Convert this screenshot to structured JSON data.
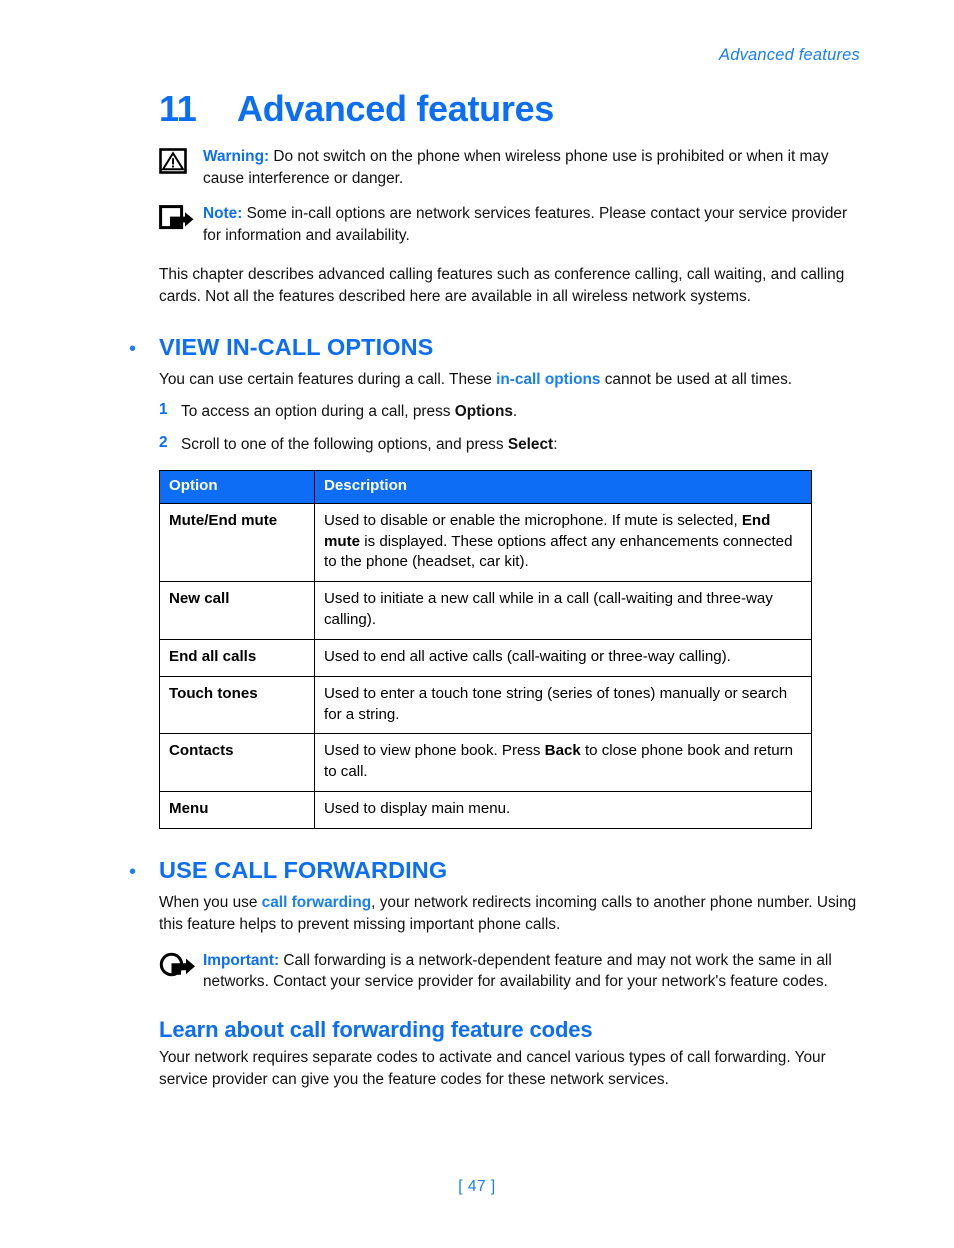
{
  "header": {
    "running_title": "Advanced features"
  },
  "chapter": {
    "number": "11",
    "title": "Advanced features"
  },
  "notices": [
    {
      "icon": "warning-triangle-icon",
      "label": "Warning:",
      "text": " Do not switch on the phone when wireless phone use is prohibited or when it may cause interference or danger."
    },
    {
      "icon": "note-arrow-icon",
      "label": "Note:",
      "text": " Some in-call options are network services features. Please contact your service provider for information and availability."
    }
  ],
  "intro_paragraph": "This chapter describes advanced calling features such as conference calling, call waiting, and calling cards. Not all the features described here are available in all wireless network systems.",
  "section_in_call": {
    "bullet": "•",
    "title": "VIEW IN-CALL OPTIONS",
    "intro_before": "You can use certain features during a call. These ",
    "intro_emphasis": "in-call options",
    "intro_after": " cannot be used at all times.",
    "steps": [
      {
        "num": "1",
        "before": "To access an option during a call, press ",
        "bold": "Options",
        "after": "."
      },
      {
        "num": "2",
        "before": "Scroll to one of the following options, and press ",
        "bold": "Select",
        "after": ":"
      }
    ],
    "table": {
      "columns": [
        "Option",
        "Description"
      ],
      "rows": [
        {
          "option": "Mute/End mute",
          "description_parts": [
            {
              "text": "Used to disable or enable the microphone. If mute is selected, ",
              "bold": false
            },
            {
              "text": "End mute",
              "bold": true
            },
            {
              "text": " is displayed. These options affect any enhancements connected to the phone (headset, car kit).",
              "bold": false
            }
          ]
        },
        {
          "option": "New call",
          "description_parts": [
            {
              "text": "Used to initiate a new call while in a call (call-waiting and three-way calling).",
              "bold": false
            }
          ]
        },
        {
          "option": "End all calls",
          "description_parts": [
            {
              "text": "Used to end all active calls (call-waiting or three-way calling).",
              "bold": false
            }
          ]
        },
        {
          "option": "Touch tones",
          "description_parts": [
            {
              "text": "Used to enter a touch tone string (series of tones) manually or search for a string.",
              "bold": false
            }
          ]
        },
        {
          "option": "Contacts",
          "description_parts": [
            {
              "text": "Used to view phone book. Press ",
              "bold": false
            },
            {
              "text": "Back",
              "bold": true
            },
            {
              "text": " to close phone book and return to call.",
              "bold": false
            }
          ]
        },
        {
          "option": "Menu",
          "description_parts": [
            {
              "text": "Used to display main menu.",
              "bold": false
            }
          ]
        }
      ]
    }
  },
  "section_forwarding": {
    "bullet": "•",
    "title": "USE CALL FORWARDING",
    "intro_before": "When you use ",
    "intro_emphasis": "call forwarding",
    "intro_after": ", your network redirects incoming calls to another phone number. Using this feature helps to prevent missing important phone calls.",
    "important_notice": {
      "icon": "important-circle-arrow-icon",
      "label": "Important:",
      "text": " Call forwarding is a network-dependent feature and may not work the same in all networks. Contact your service provider for availability and for your network's feature codes."
    },
    "subsection": {
      "title": "Learn about call forwarding feature codes",
      "text": "Your network requires separate codes to activate and cancel various types of call forwarding. Your service provider can give you the feature codes for these network services."
    }
  },
  "footer": {
    "page_number": "[ 47 ]"
  },
  "colors": {
    "accent_blue": "#0b6ef5",
    "light_blue": "#1a7ef5",
    "table_header_bg": "#0d6ef5",
    "text_black": "#111111"
  }
}
